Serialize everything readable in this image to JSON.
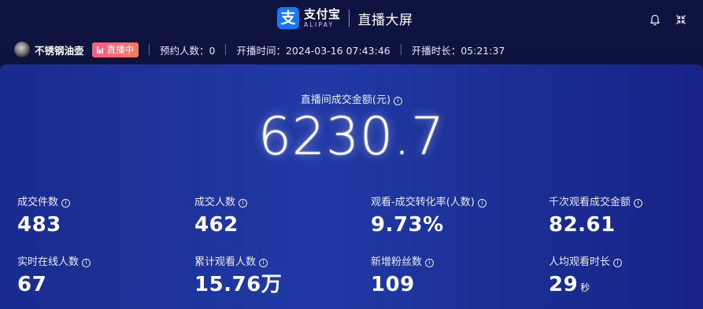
{
  "header": {
    "logo_mark": "支",
    "logo_cn": "支付宝",
    "logo_en": "ALIPAY",
    "screen_title": "直播大屏",
    "icons": [
      "bell-icon",
      "shrink-icon"
    ]
  },
  "info_bar": {
    "host_name": "不锈钢油壶",
    "live_status": "直播中",
    "reservations": "预约人数：0",
    "start_time": "开播时间：2024-03-16 07:43:46",
    "duration": "开播时长：05:21:37"
  },
  "total": {
    "label": "直播间成交金额(元)",
    "value": "6230.7"
  },
  "metrics": [
    {
      "label": "成交件数",
      "value": "483",
      "unit": ""
    },
    {
      "label": "成交人数",
      "value": "462",
      "unit": ""
    },
    {
      "label": "观看-成交转化率(人数)",
      "value": "9.73%",
      "unit": ""
    },
    {
      "label": "千次观看成交金额",
      "value": "82.61",
      "unit": ""
    },
    {
      "label": "实时在线人数",
      "value": "67",
      "unit": ""
    },
    {
      "label": "累计观看人数",
      "value": "15.76万",
      "unit": ""
    },
    {
      "label": "新增粉丝数",
      "value": "109",
      "unit": ""
    },
    {
      "label": "人均观看时长",
      "value": "29",
      "unit": "秒"
    }
  ],
  "info_icon_glyph": "i",
  "colors": {
    "background": "#0e1340",
    "panel": "#213aa6",
    "live_badge": "#ff6a6f",
    "alipay_blue": "#1677ff"
  }
}
